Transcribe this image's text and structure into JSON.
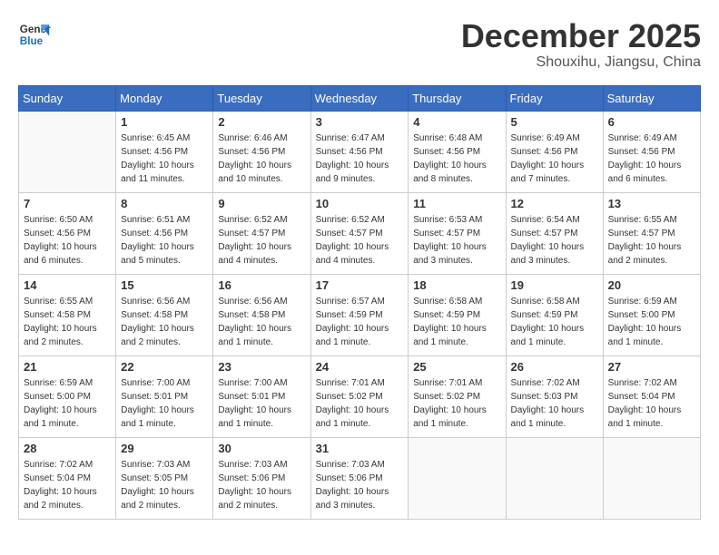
{
  "header": {
    "logo_line1": "General",
    "logo_line2": "Blue",
    "month": "December 2025",
    "location": "Shouxihu, Jiangsu, China"
  },
  "weekdays": [
    "Sunday",
    "Monday",
    "Tuesday",
    "Wednesday",
    "Thursday",
    "Friday",
    "Saturday"
  ],
  "weeks": [
    [
      {
        "day": "",
        "info": ""
      },
      {
        "day": "1",
        "info": "Sunrise: 6:45 AM\nSunset: 4:56 PM\nDaylight: 10 hours\nand 11 minutes."
      },
      {
        "day": "2",
        "info": "Sunrise: 6:46 AM\nSunset: 4:56 PM\nDaylight: 10 hours\nand 10 minutes."
      },
      {
        "day": "3",
        "info": "Sunrise: 6:47 AM\nSunset: 4:56 PM\nDaylight: 10 hours\nand 9 minutes."
      },
      {
        "day": "4",
        "info": "Sunrise: 6:48 AM\nSunset: 4:56 PM\nDaylight: 10 hours\nand 8 minutes."
      },
      {
        "day": "5",
        "info": "Sunrise: 6:49 AM\nSunset: 4:56 PM\nDaylight: 10 hours\nand 7 minutes."
      },
      {
        "day": "6",
        "info": "Sunrise: 6:49 AM\nSunset: 4:56 PM\nDaylight: 10 hours\nand 6 minutes."
      }
    ],
    [
      {
        "day": "7",
        "info": "Sunrise: 6:50 AM\nSunset: 4:56 PM\nDaylight: 10 hours\nand 6 minutes."
      },
      {
        "day": "8",
        "info": "Sunrise: 6:51 AM\nSunset: 4:56 PM\nDaylight: 10 hours\nand 5 minutes."
      },
      {
        "day": "9",
        "info": "Sunrise: 6:52 AM\nSunset: 4:57 PM\nDaylight: 10 hours\nand 4 minutes."
      },
      {
        "day": "10",
        "info": "Sunrise: 6:52 AM\nSunset: 4:57 PM\nDaylight: 10 hours\nand 4 minutes."
      },
      {
        "day": "11",
        "info": "Sunrise: 6:53 AM\nSunset: 4:57 PM\nDaylight: 10 hours\nand 3 minutes."
      },
      {
        "day": "12",
        "info": "Sunrise: 6:54 AM\nSunset: 4:57 PM\nDaylight: 10 hours\nand 3 minutes."
      },
      {
        "day": "13",
        "info": "Sunrise: 6:55 AM\nSunset: 4:57 PM\nDaylight: 10 hours\nand 2 minutes."
      }
    ],
    [
      {
        "day": "14",
        "info": "Sunrise: 6:55 AM\nSunset: 4:58 PM\nDaylight: 10 hours\nand 2 minutes."
      },
      {
        "day": "15",
        "info": "Sunrise: 6:56 AM\nSunset: 4:58 PM\nDaylight: 10 hours\nand 2 minutes."
      },
      {
        "day": "16",
        "info": "Sunrise: 6:56 AM\nSunset: 4:58 PM\nDaylight: 10 hours\nand 1 minute."
      },
      {
        "day": "17",
        "info": "Sunrise: 6:57 AM\nSunset: 4:59 PM\nDaylight: 10 hours\nand 1 minute."
      },
      {
        "day": "18",
        "info": "Sunrise: 6:58 AM\nSunset: 4:59 PM\nDaylight: 10 hours\nand 1 minute."
      },
      {
        "day": "19",
        "info": "Sunrise: 6:58 AM\nSunset: 4:59 PM\nDaylight: 10 hours\nand 1 minute."
      },
      {
        "day": "20",
        "info": "Sunrise: 6:59 AM\nSunset: 5:00 PM\nDaylight: 10 hours\nand 1 minute."
      }
    ],
    [
      {
        "day": "21",
        "info": "Sunrise: 6:59 AM\nSunset: 5:00 PM\nDaylight: 10 hours\nand 1 minute."
      },
      {
        "day": "22",
        "info": "Sunrise: 7:00 AM\nSunset: 5:01 PM\nDaylight: 10 hours\nand 1 minute."
      },
      {
        "day": "23",
        "info": "Sunrise: 7:00 AM\nSunset: 5:01 PM\nDaylight: 10 hours\nand 1 minute."
      },
      {
        "day": "24",
        "info": "Sunrise: 7:01 AM\nSunset: 5:02 PM\nDaylight: 10 hours\nand 1 minute."
      },
      {
        "day": "25",
        "info": "Sunrise: 7:01 AM\nSunset: 5:02 PM\nDaylight: 10 hours\nand 1 minute."
      },
      {
        "day": "26",
        "info": "Sunrise: 7:02 AM\nSunset: 5:03 PM\nDaylight: 10 hours\nand 1 minute."
      },
      {
        "day": "27",
        "info": "Sunrise: 7:02 AM\nSunset: 5:04 PM\nDaylight: 10 hours\nand 1 minute."
      }
    ],
    [
      {
        "day": "28",
        "info": "Sunrise: 7:02 AM\nSunset: 5:04 PM\nDaylight: 10 hours\nand 2 minutes."
      },
      {
        "day": "29",
        "info": "Sunrise: 7:03 AM\nSunset: 5:05 PM\nDaylight: 10 hours\nand 2 minutes."
      },
      {
        "day": "30",
        "info": "Sunrise: 7:03 AM\nSunset: 5:06 PM\nDaylight: 10 hours\nand 2 minutes."
      },
      {
        "day": "31",
        "info": "Sunrise: 7:03 AM\nSunset: 5:06 PM\nDaylight: 10 hours\nand 3 minutes."
      },
      {
        "day": "",
        "info": ""
      },
      {
        "day": "",
        "info": ""
      },
      {
        "day": "",
        "info": ""
      }
    ]
  ]
}
